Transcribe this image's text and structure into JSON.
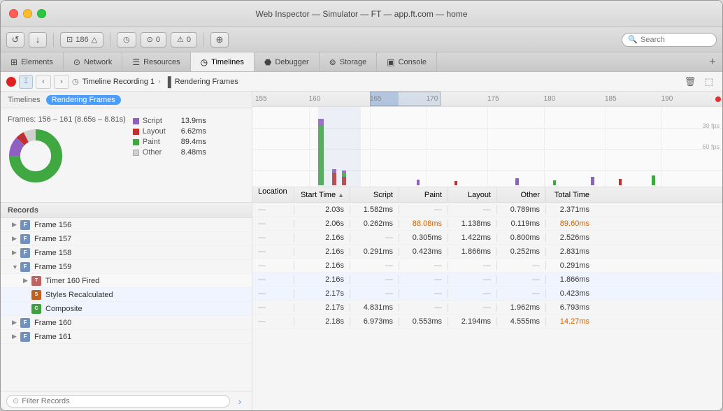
{
  "window": {
    "title": "Web Inspector — Simulator — FT — app.ft.com — home"
  },
  "toolbar": {
    "badge_count": "186",
    "badge_errors": "0",
    "badge_warnings": "0",
    "badge_logs": "0",
    "search_placeholder": "Search"
  },
  "tabs": [
    {
      "id": "elements",
      "label": "Elements",
      "icon": "⊞"
    },
    {
      "id": "network",
      "label": "Network",
      "icon": "⊙"
    },
    {
      "id": "resources",
      "label": "Resources",
      "icon": "☰"
    },
    {
      "id": "timelines",
      "label": "Timelines",
      "icon": "◷",
      "active": true
    },
    {
      "id": "debugger",
      "label": "Debugger",
      "icon": "⬣"
    },
    {
      "id": "storage",
      "label": "Storage",
      "icon": "⊚"
    },
    {
      "id": "console",
      "label": "Console",
      "icon": "▣"
    }
  ],
  "sub_toolbar": {
    "recording_label": "Timeline Recording 1",
    "view_label": "Rendering Frames"
  },
  "left_panel": {
    "tabs": [
      {
        "id": "timelines",
        "label": "Timelines"
      },
      {
        "id": "rendering_frames",
        "label": "Rendering Frames",
        "active": true
      }
    ],
    "chart_title": "Frames: 156 – 161 (8.65s – 8.81s)",
    "legend": [
      {
        "label": "Script",
        "value": "13.9ms",
        "color": "#9060c0"
      },
      {
        "label": "Layout",
        "value": "6.62ms",
        "color": "#c03030"
      },
      {
        "label": "Paint",
        "value": "89.4ms",
        "color": "#40a840"
      },
      {
        "label": "Other",
        "value": "8.48ms",
        "color": "#d0d0d0"
      }
    ]
  },
  "records_header": {
    "col_records": "Records",
    "col_location": "Location",
    "col_starttime": "Start Time",
    "col_script": "Script",
    "col_paint": "Paint",
    "col_layout": "Layout",
    "col_other": "Other",
    "col_totaltime": "Total Time"
  },
  "records": [
    {
      "id": "frame156",
      "name": "Frame 156",
      "indent": 0,
      "expanded": false,
      "badge": "F",
      "badge_class": "badge-frame",
      "location": "—",
      "start_time": "2.03s",
      "script": "1.582ms",
      "paint": "—",
      "layout": "—",
      "other": "0.789ms",
      "total_time": "2.371ms"
    },
    {
      "id": "frame157",
      "name": "Frame 157",
      "indent": 0,
      "expanded": false,
      "badge": "F",
      "badge_class": "badge-frame",
      "location": "—",
      "start_time": "2.06s",
      "script": "0.262ms",
      "paint": "88.08ms",
      "layout": "1.138ms",
      "other": "0.119ms",
      "total_time": "89.60ms"
    },
    {
      "id": "frame158",
      "name": "Frame 158",
      "indent": 0,
      "expanded": false,
      "badge": "F",
      "badge_class": "badge-frame",
      "location": "—",
      "start_time": "2.16s",
      "script": "—",
      "paint": "0.305ms",
      "layout": "1.422ms",
      "other": "0.800ms",
      "total_time": "2.526ms"
    },
    {
      "id": "frame159",
      "name": "Frame 159",
      "indent": 0,
      "expanded": true,
      "badge": "F",
      "badge_class": "badge-frame",
      "location": "—",
      "start_time": "2.16s",
      "script": "0.291ms",
      "paint": "0.423ms",
      "layout": "1.866ms",
      "other": "0.252ms",
      "total_time": "2.831ms"
    },
    {
      "id": "timer160",
      "name": "Timer 160 Fired",
      "indent": 1,
      "expanded": false,
      "badge": "T",
      "badge_class": "badge-timer",
      "location": "—",
      "start_time": "2.16s",
      "script": "—",
      "paint": "—",
      "layout": "—",
      "other": "—",
      "total_time": "0.291ms"
    },
    {
      "id": "styles",
      "name": "Styles Recalculated",
      "indent": 1,
      "expanded": false,
      "badge": "S",
      "badge_class": "badge-styles",
      "location": "—",
      "start_time": "2.16s",
      "script": "—",
      "paint": "—",
      "layout": "—",
      "other": "—",
      "total_time": "1.866ms"
    },
    {
      "id": "composite",
      "name": "Composite",
      "indent": 1,
      "expanded": false,
      "badge": "C",
      "badge_class": "badge-composite",
      "location": "—",
      "start_time": "2.17s",
      "script": "—",
      "paint": "—",
      "layout": "—",
      "other": "—",
      "total_time": "0.423ms"
    },
    {
      "id": "frame160",
      "name": "Frame 160",
      "indent": 0,
      "expanded": false,
      "badge": "F",
      "badge_class": "badge-frame",
      "location": "—",
      "start_time": "2.17s",
      "script": "4.831ms",
      "paint": "—",
      "layout": "—",
      "other": "1.962ms",
      "total_time": "6.793ms"
    },
    {
      "id": "frame161",
      "name": "Frame 161",
      "indent": 0,
      "expanded": false,
      "badge": "F",
      "badge_class": "badge-frame",
      "location": "—",
      "start_time": "2.18s",
      "script": "6.973ms",
      "paint": "0.553ms",
      "layout": "2.194ms",
      "other": "4.555ms",
      "total_time": "14.27ms"
    }
  ],
  "filter": {
    "placeholder": "Filter Records"
  },
  "timeline": {
    "ruler_marks": [
      "155",
      "160",
      "165",
      "170",
      "175",
      "180",
      "185",
      "190"
    ],
    "fps_30": "30 fps",
    "fps_60": "60 fps"
  }
}
